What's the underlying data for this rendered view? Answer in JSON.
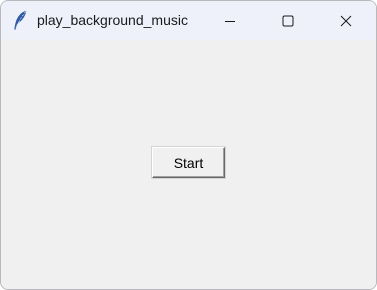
{
  "window": {
    "title": "play_background_music",
    "icon": "feather-icon",
    "controls": {
      "minimize_icon": "minimize-icon",
      "maximize_icon": "maximize-icon",
      "close_icon": "close-icon"
    }
  },
  "main": {
    "start_label": "Start"
  },
  "colors": {
    "titlebar_bg": "#eef1fa",
    "client_bg": "#f0f0f0",
    "feather_blue": "#2d5aa6"
  }
}
